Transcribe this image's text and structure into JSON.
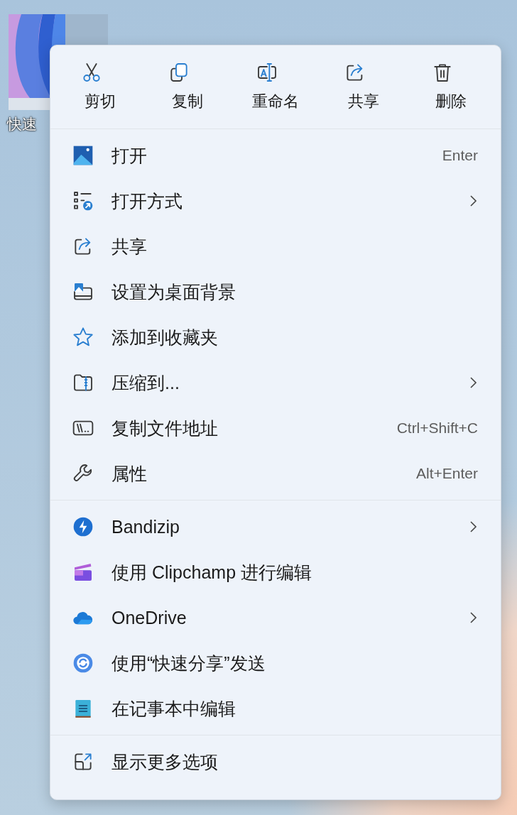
{
  "desktop_icon": {
    "label": "快速"
  },
  "toolbar": [
    {
      "kind": "cut",
      "label": "剪切"
    },
    {
      "kind": "copy",
      "label": "复制"
    },
    {
      "kind": "rename",
      "label": "重命名"
    },
    {
      "kind": "share",
      "label": "共享"
    },
    {
      "kind": "delete",
      "label": "删除"
    }
  ],
  "groups": [
    {
      "items": [
        {
          "kind": "photos",
          "label": "打开",
          "shortcut": "Enter",
          "submenu": false
        },
        {
          "kind": "open-with",
          "label": "打开方式",
          "submenu": true
        },
        {
          "kind": "share",
          "label": "共享",
          "submenu": false
        },
        {
          "kind": "wallpaper",
          "label": "设置为桌面背景",
          "submenu": false
        },
        {
          "kind": "star",
          "label": "添加到收藏夹",
          "submenu": false
        },
        {
          "kind": "zip",
          "label": "压缩到...",
          "submenu": true
        },
        {
          "kind": "path",
          "label": "复制文件地址",
          "shortcut": "Ctrl+Shift+C",
          "submenu": false
        },
        {
          "kind": "wrench",
          "label": "属性",
          "shortcut": "Alt+Enter",
          "submenu": false
        }
      ]
    },
    {
      "items": [
        {
          "kind": "bandizip",
          "label": "Bandizip",
          "submenu": true
        },
        {
          "kind": "clipchamp",
          "label": "使用 Clipchamp 进行编辑",
          "submenu": false
        },
        {
          "kind": "onedrive",
          "label": "OneDrive",
          "submenu": true
        },
        {
          "kind": "nearby",
          "label": "使用“快速分享”发送",
          "submenu": false
        },
        {
          "kind": "notepad",
          "label": "在记事本中编辑",
          "submenu": false
        }
      ]
    },
    {
      "items": [
        {
          "kind": "more",
          "label": "显示更多选项",
          "submenu": false
        }
      ]
    }
  ]
}
